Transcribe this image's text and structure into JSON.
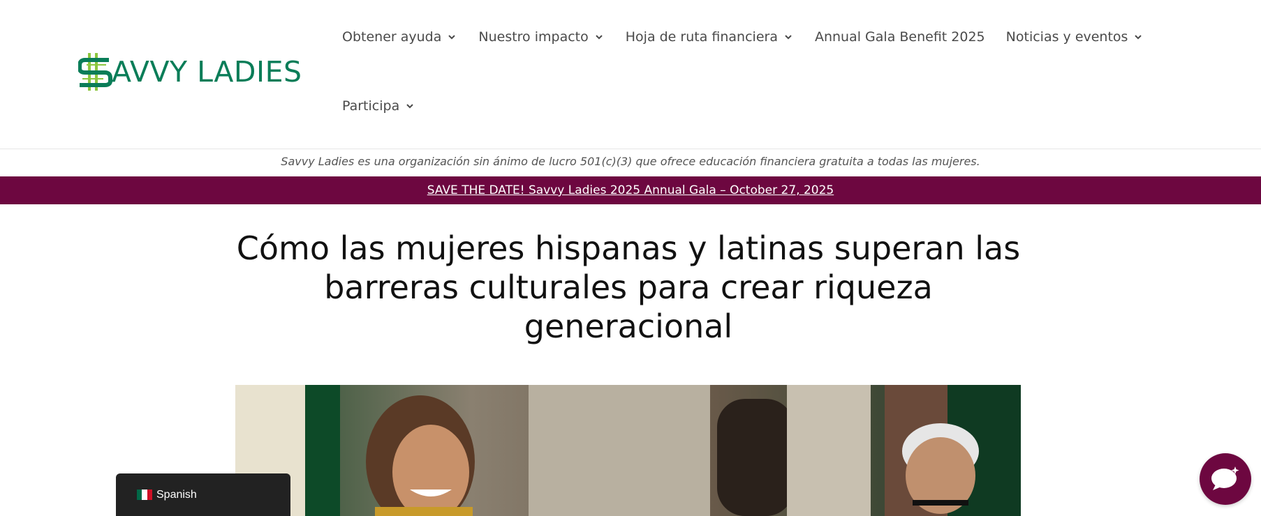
{
  "brand": {
    "logo_text": "AVVY LADIES",
    "logo_color": "#0a7d58",
    "logo_accent": "#8cc63f"
  },
  "nav": {
    "items": [
      {
        "label": "Obtener ayuda",
        "dropdown": true
      },
      {
        "label": "Nuestro impacto",
        "dropdown": true
      },
      {
        "label": "Hoja de ruta financiera",
        "dropdown": true
      },
      {
        "label": "Annual Gala Benefit 2025",
        "dropdown": false
      },
      {
        "label": "Noticias y eventos",
        "dropdown": true
      },
      {
        "label": "Participa",
        "dropdown": true
      }
    ],
    "chevron_icon": "chevron-down-icon"
  },
  "tagline": "Savvy Ladies es una organización sin ánimo de lucro 501(c)(3) que ofrece educación financiera gratuita a todas las mujeres.",
  "banner": {
    "text": "SAVE THE DATE! Savvy Ladies 2025 Annual Gala – October 27, 2025",
    "background": "#6d0740"
  },
  "article": {
    "title": "Cómo las mujeres hispanas y latinas superan las barreras culturales para crear riqueza generacional",
    "hero_image": "photo-women-laughing-with-older-man"
  },
  "language_switcher": {
    "label": "Spanish",
    "flag_icon": "mexico-flag-icon"
  },
  "chat": {
    "icon": "chat-bubble-icon",
    "color": "#6d0740"
  }
}
